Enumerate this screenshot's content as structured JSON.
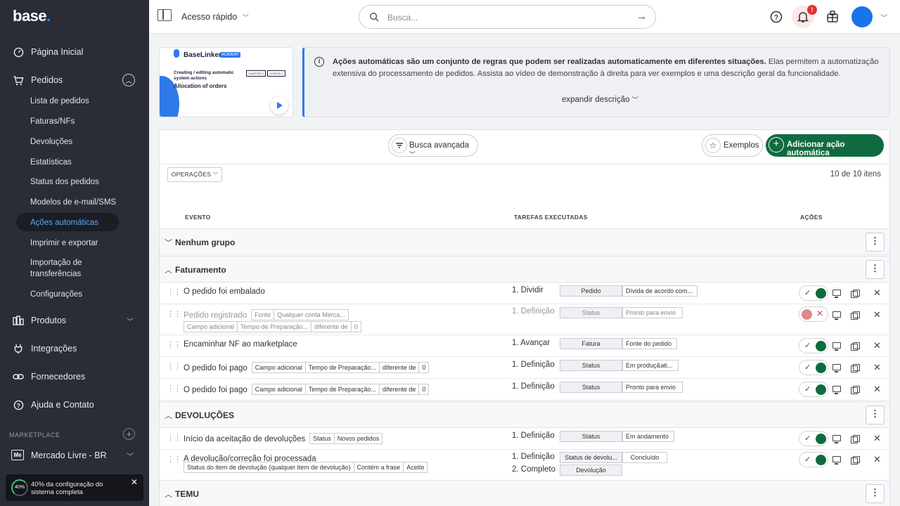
{
  "sidebar": {
    "logo": "base",
    "nav": [
      {
        "label": "Página Inicial",
        "icon": "gauge-icon"
      },
      {
        "label": "Pedidos",
        "icon": "cart-icon"
      },
      {
        "label": "Produtos",
        "icon": "products-icon"
      },
      {
        "label": "Integrações",
        "icon": "plug-icon"
      },
      {
        "label": "Fornecedores",
        "icon": "link-icon"
      },
      {
        "label": "Ajuda e Contato",
        "icon": "help-icon"
      }
    ],
    "pedidos_sub": [
      "Lista de pedidos",
      "Faturas/NFs",
      "Devoluções",
      "Estatísticas",
      "Status dos pedidos",
      "Modelos de e-mail/SMS",
      "Ações automáticas",
      "Imprimir e exportar",
      "Importação de transferências",
      "Configurações"
    ],
    "marketplace_label": "MARKETPLACE",
    "marketplace_item": "Mercado Livre - BR",
    "marketplace_badge": "Me",
    "toast_percent": "40%",
    "toast_text": "40% da configuração do sistema completa"
  },
  "header": {
    "quick_access": "Acesso rápido",
    "search_placeholder": "Busca...",
    "notification_count": "!"
  },
  "banner": {
    "video": {
      "brand": "BaseLinker",
      "academy": "ACADEMY",
      "line1": "Creating / editing automatic system actions",
      "line2": "Allocation of orders",
      "chapter": "CHAPTER 3",
      "lesson": "LESSON 1"
    },
    "info_bold": "Ações automáticas são um conjunto de regras que podem ser realizadas automaticamente em diferentes situações.",
    "info_rest": " Elas permitem a automatização extensiva do processamento de pedidos. Assista ao vídeo de demonstração à direita para ver exemplos e uma descrição geral da funcionalidade.",
    "expand": "expandir descrição"
  },
  "toolbar": {
    "advanced_search": "Busca avançada",
    "examples": "Exemplos",
    "add": "Adicionar ação automática",
    "operations": "OPERAÇÕES",
    "count": "10 de 10 itens"
  },
  "table": {
    "headers": {
      "event": "EVENTO",
      "tasks": "TAREFAS EXECUTADAS",
      "actions": "AÇÕES"
    },
    "groups": {
      "none": "Nenhum grupo",
      "billing": "Faturamento",
      "returns": "DEVOLUÇÕES",
      "temu": "TEMU"
    },
    "rows": [
      {
        "event": "O pedido foi embalado",
        "tags": [],
        "task_num": "1. Dividir",
        "task_key": "Pedido",
        "task_val": "Dívida de acordo com..."
      },
      {
        "event": "Pedido registrado",
        "tags": [
          "Fonte",
          "Qualquer conta Merca..."
        ],
        "tags2": [
          "Campo adicional",
          "Tempo de Preparação...",
          "diferente de",
          "0"
        ],
        "task_num": "1. Definição",
        "task_key": "Status",
        "task_val": "Pronto para envio"
      },
      {
        "event": "Encaminhar NF ao marketplace",
        "tags": [],
        "task_num": "1. Avançar",
        "task_key": "Fatura",
        "task_val": "Fonte do pedido"
      },
      {
        "event": "O pedido foi pago",
        "tags": [
          "Campo adicional",
          "Tempo de Preparação...",
          "diferente de",
          "0"
        ],
        "task_num": "1. Definição",
        "task_key": "Status",
        "task_val": "Em produç&ati..."
      },
      {
        "event": "O pedido foi pago",
        "tags": [
          "Campo adicional",
          "Tempo de Preparação...",
          "diferente de",
          "0"
        ],
        "task_num": "1. Definição",
        "task_key": "Status",
        "task_val": "Pronto para envio"
      },
      {
        "event": "Início da aceitação de devoluções",
        "tags": [
          "Status",
          "Novos pedidos"
        ],
        "task_num": "1. Definição",
        "task_key": "Status",
        "task_val": "Em andamento"
      },
      {
        "event": "A devolução/correção foi processada",
        "tags2": [
          "Status do item de devolução (qualquer item de devolução)",
          "Contém a frase",
          "Aceito"
        ],
        "task_num": "1. Definição",
        "task_key": "Status de devolu...",
        "task_val": "Concluído",
        "task_num2": "2. Completo",
        "task_key2": "Devolução"
      }
    ]
  }
}
